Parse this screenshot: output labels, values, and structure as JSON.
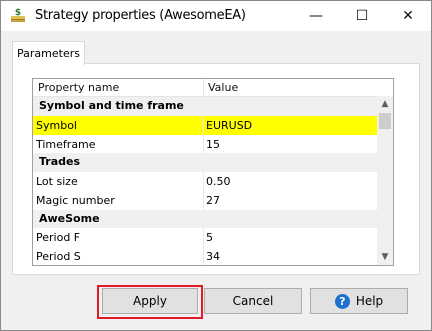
{
  "window": {
    "title": "Strategy properties (AwesomeEA)",
    "minimize_glyph": "—",
    "maximize_glyph": "☐",
    "close_glyph": "✕"
  },
  "tabs": [
    {
      "label": "Parameters",
      "active": true
    }
  ],
  "grid": {
    "headers": {
      "name": "Property name",
      "value": "Value"
    },
    "rows": [
      {
        "name": "Symbol and time frame",
        "value": "",
        "type": "section"
      },
      {
        "name": "Symbol",
        "value": "EURUSD",
        "type": "property",
        "selected": true
      },
      {
        "name": "Timeframe",
        "value": "15",
        "type": "property"
      },
      {
        "name": "Trades",
        "value": "",
        "type": "section"
      },
      {
        "name": "Lot size",
        "value": "0.50",
        "type": "property"
      },
      {
        "name": "Magic number",
        "value": "27",
        "type": "property"
      },
      {
        "name": "AweSome",
        "value": "",
        "type": "section"
      },
      {
        "name": "Period F",
        "value": "5",
        "type": "property"
      },
      {
        "name": "Period S",
        "value": "34",
        "type": "property"
      }
    ],
    "scroll_up_glyph": "▲",
    "scroll_down_glyph": "▼"
  },
  "buttons": {
    "apply": "Apply",
    "cancel": "Cancel",
    "help": "Help",
    "help_icon_glyph": "?"
  },
  "colors": {
    "selected_row": "#ffff00",
    "section_row": "#f0f0f0",
    "highlight_border": "#e01b24",
    "help_icon": "#1e6fcf"
  },
  "icons": {
    "app": "dollar-coins-icon",
    "help": "question-circle-icon",
    "scroll_up": "triangle-up-icon",
    "scroll_down": "triangle-down-icon"
  }
}
